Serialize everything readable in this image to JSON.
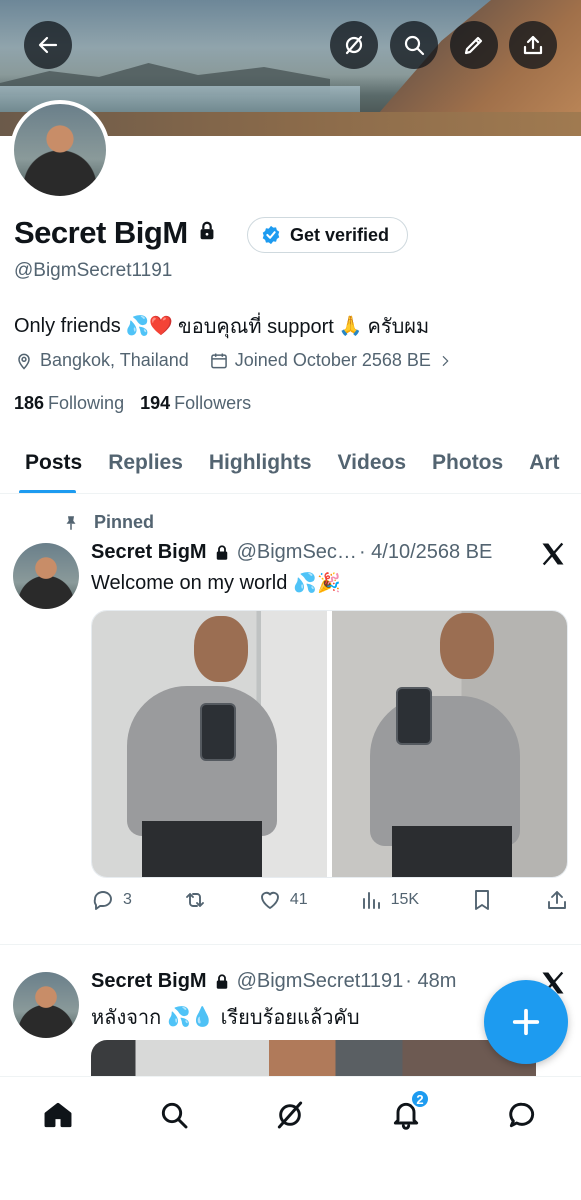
{
  "profile": {
    "display_name": "Secret BigM",
    "handle": "@BigmSecret1191",
    "verify_label": "Get verified",
    "bio_text1": "Only friends",
    "bio_emoji1": "💦❤️",
    "bio_text2": "ขอบคุณที่ support",
    "bio_emoji2": "🙏",
    "bio_text3": "ครับผม",
    "location": "Bangkok, Thailand",
    "joined": "Joined October 2568 BE",
    "following_count": "186",
    "following_label": "Following",
    "followers_count": "194",
    "followers_label": "Followers"
  },
  "tabs": [
    "Posts",
    "Replies",
    "Highlights",
    "Videos",
    "Photos",
    "Art"
  ],
  "pinned_post": {
    "pinned_label": "Pinned",
    "author": "Secret BigM",
    "handle": "@BigmSec…",
    "date": "· 4/10/2568 BE",
    "text": "Welcome on my world",
    "emoji": "💦🎉",
    "replies": "3",
    "likes": "41",
    "views": "15K"
  },
  "second_post": {
    "author": "Secret BigM",
    "handle": "@BigmSecret1191",
    "time": "· 48m",
    "text1": "หลังจาก",
    "emoji": "💦💧",
    "text2": "เรียบร้อยแล้วคับ"
  },
  "notifications_badge": "2",
  "colors": {
    "accent": "#1d9bf0",
    "text": "#0f1419",
    "secondary": "#536471"
  }
}
